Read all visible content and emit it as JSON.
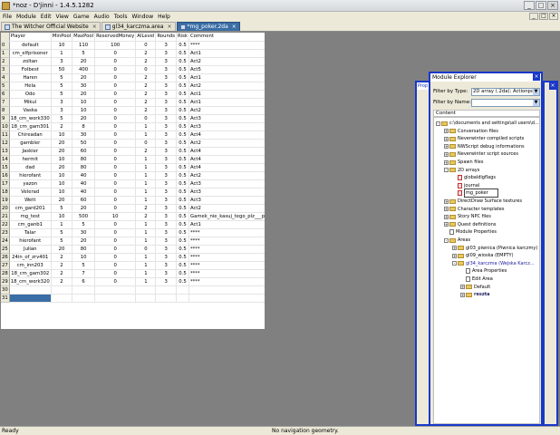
{
  "window": {
    "title": "*noz - D'jinni - 1.4.5.1282"
  },
  "menu": [
    "File",
    "Module",
    "Edit",
    "View",
    "Game",
    "Audio",
    "Tools",
    "Window",
    "Help"
  ],
  "tabs": [
    {
      "label": "The Witcher Official Website",
      "active": false
    },
    {
      "label": "gl34_karczma.area",
      "active": false
    },
    {
      "label": "*mg_poker.2da",
      "active": true
    }
  ],
  "grid": {
    "columns": [
      "Player",
      "MinPool",
      "MaxPool",
      "ReservedMoney",
      "AILevel",
      "Rounds",
      "Risk",
      "Comment"
    ],
    "rows": [
      [
        "default",
        "10",
        "110",
        "100",
        "0",
        "3",
        "0.5",
        "****"
      ],
      [
        "cm_elfprisoner",
        "1",
        "5",
        "0",
        "2",
        "3",
        "0.5",
        "Act1"
      ],
      [
        "zoltan",
        "3",
        "20",
        "0",
        "2",
        "3",
        "0.5",
        "Act2"
      ],
      [
        "Folbest",
        "50",
        "400",
        "0",
        "0",
        "3",
        "0.5",
        "Act5"
      ],
      [
        "Haren",
        "5",
        "20",
        "0",
        "2",
        "3",
        "0.5",
        "Act1"
      ],
      [
        "Hela",
        "5",
        "30",
        "0",
        "2",
        "3",
        "0.5",
        "Act2"
      ],
      [
        "Odo",
        "5",
        "20",
        "0",
        "2",
        "3",
        "0.5",
        "Act1"
      ],
      [
        "Mikul",
        "3",
        "10",
        "0",
        "2",
        "3",
        "0.5",
        "Act1"
      ],
      [
        "Vaska",
        "3",
        "10",
        "0",
        "2",
        "3",
        "0.5",
        "Act2"
      ],
      [
        "18_cm_work330",
        "5",
        "20",
        "0",
        "0",
        "3",
        "0.5",
        "Act3"
      ],
      [
        "18_cm_gam301",
        "2",
        "8",
        "0",
        "1",
        "3",
        "0.5",
        "Act3"
      ],
      [
        "Chireadan",
        "10",
        "30",
        "0",
        "1",
        "3",
        "0.5",
        "Act4"
      ],
      [
        "gambler",
        "20",
        "50",
        "0",
        "0",
        "3",
        "0.5",
        "Act2"
      ],
      [
        "Jaskier",
        "20",
        "60",
        "0",
        "2",
        "3",
        "0.5",
        "Act4"
      ],
      [
        "hermit",
        "10",
        "80",
        "0",
        "1",
        "3",
        "0.5",
        "Act4"
      ],
      [
        "dad",
        "20",
        "80",
        "0",
        "1",
        "3",
        "0.5",
        "Act4"
      ],
      [
        "hierofant",
        "10",
        "40",
        "0",
        "1",
        "3",
        "0.5",
        "Act2"
      ],
      [
        "yazon",
        "10",
        "40",
        "0",
        "1",
        "3",
        "0.5",
        "Act3"
      ],
      [
        "Velerad",
        "10",
        "40",
        "0",
        "1",
        "3",
        "0.5",
        "Act3"
      ],
      [
        "Wett",
        "20",
        "60",
        "0",
        "1",
        "3",
        "0.5",
        "Act3"
      ],
      [
        "cm_gard201",
        "5",
        "20",
        "0",
        "2",
        "3",
        "0.5",
        "Act2"
      ],
      [
        "mg_test",
        "10",
        "500",
        "10",
        "2",
        "3",
        "0.5",
        "Gamek_nie_kasuj_tego_plz___programisci"
      ],
      [
        "cm_ganb1",
        "1",
        "5",
        "0",
        "1",
        "3",
        "0.5",
        "Act1"
      ],
      [
        "Talar",
        "5",
        "30",
        "0",
        "1",
        "3",
        "0.5",
        "****"
      ],
      [
        "hierofant",
        "5",
        "20",
        "0",
        "1",
        "3",
        "0.5",
        "****"
      ],
      [
        "Julian",
        "20",
        "80",
        "0",
        "0",
        "3",
        "0.5",
        "****"
      ],
      [
        "24in_of_zrv401",
        "2",
        "10",
        "0",
        "1",
        "3",
        "0.5",
        "****"
      ],
      [
        "cm_inn203",
        "2",
        "5",
        "0",
        "1",
        "3",
        "0.5",
        "****"
      ],
      [
        "18_cm_gam302",
        "2",
        "7",
        "0",
        "1",
        "3",
        "0.5",
        "****"
      ],
      [
        "18_cm_work320",
        "2",
        "6",
        "0",
        "1",
        "3",
        "0.5",
        "****"
      ],
      [
        "",
        "",
        "",
        "",
        "",
        "",
        "",
        ""
      ],
      [
        "",
        "",
        "",
        "",
        "",
        "",
        "",
        ""
      ]
    ]
  },
  "explorer": {
    "title": "Module Explorer",
    "filter_type_label": "Filter by Type:",
    "filter_type_value": "2D array (.2da); Actionpoi...",
    "filter_name_label": "Filter by Name:",
    "filter_name_value": "",
    "content_header": "Content",
    "tree": [
      {
        "label": "c:\\documents and settings\\all users\\d...",
        "indent": 0,
        "exp": "-",
        "icon": "fld"
      },
      {
        "label": "Conversation files",
        "indent": 1,
        "exp": "+",
        "icon": "fld"
      },
      {
        "label": "Neverwinter compiled scripts",
        "indent": 1,
        "exp": "+",
        "icon": "fld"
      },
      {
        "label": "NWScript debug informations",
        "indent": 1,
        "exp": "+",
        "icon": "fld"
      },
      {
        "label": "Neverwinter script sources",
        "indent": 1,
        "exp": "+",
        "icon": "fld"
      },
      {
        "label": "Spawn files",
        "indent": 1,
        "exp": "+",
        "icon": "fld"
      },
      {
        "label": "2D arrays",
        "indent": 1,
        "exp": "-",
        "icon": "fld"
      },
      {
        "label": "globaldlgflags",
        "indent": 2,
        "exp": "",
        "icon": "doc-red"
      },
      {
        "label": "journal",
        "indent": 2,
        "exp": "",
        "icon": "doc-red"
      },
      {
        "label": "mg_poker",
        "indent": 2,
        "exp": "",
        "icon": "doc-red",
        "style": "boxed"
      },
      {
        "label": "DirectDraw Surface textures",
        "indent": 1,
        "exp": "+",
        "icon": "fld"
      },
      {
        "label": "Character templates",
        "indent": 1,
        "exp": "+",
        "icon": "fld"
      },
      {
        "label": "Story NPC files",
        "indent": 1,
        "exp": "+",
        "icon": "fld"
      },
      {
        "label": "Quest definitions",
        "indent": 1,
        "exp": "+",
        "icon": "fld"
      },
      {
        "label": "Module Properties",
        "indent": 1,
        "exp": "",
        "icon": "doc"
      },
      {
        "label": "Areas",
        "indent": 1,
        "exp": "-",
        "icon": "fld"
      },
      {
        "label": "gl03_piwnica (Piwnica karczmy)",
        "indent": 2,
        "exp": "+",
        "icon": "fld"
      },
      {
        "label": "gl09_wioska (EMPTY)",
        "indent": 2,
        "exp": "+",
        "icon": "fld"
      },
      {
        "label": "gl34_karczma (Wejska Karcz...",
        "indent": 2,
        "exp": "-",
        "icon": "fld",
        "style": "blue"
      },
      {
        "label": "Area Properties",
        "indent": 3,
        "exp": "",
        "icon": "doc"
      },
      {
        "label": "Edit Area",
        "indent": 3,
        "exp": "",
        "icon": "doc"
      },
      {
        "label": "Default",
        "indent": 3,
        "exp": "+",
        "icon": "fld"
      },
      {
        "label": "reszta",
        "indent": 3,
        "exp": "+",
        "icon": "fld",
        "style": "bold"
      }
    ]
  },
  "props_panel": {
    "title": "Prop"
  },
  "status": {
    "left": "Ready",
    "middle": "No navigation geometry."
  }
}
